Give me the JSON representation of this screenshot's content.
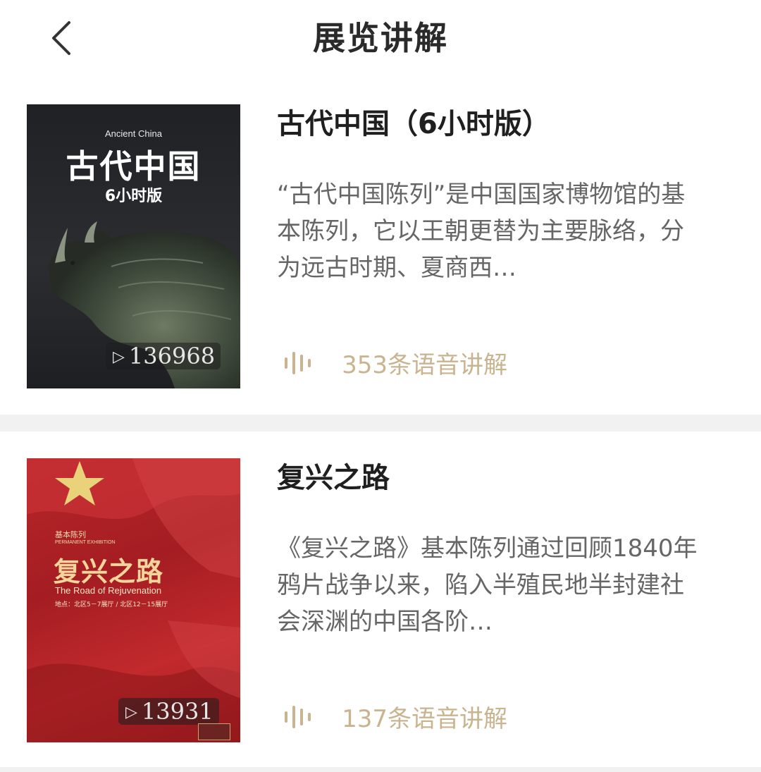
{
  "header": {
    "title": "展览讲解",
    "back_icon": "chevron-left-icon"
  },
  "exhibitions": [
    {
      "title": "古代中国（6小时版）",
      "description": "“古代中国陈列”是中国国家博物馆的基本陈列，它以王朝更替为主要脉络，分为远古时期、夏商西…",
      "audio_count_text": "353条语音讲解",
      "cover": {
        "english": "Ancient China",
        "chinese": "古代中国",
        "subtitle": "6小时版",
        "play_count": "136968"
      }
    },
    {
      "title": "复兴之路",
      "description": "《复兴之路》基本陈列通过回顾1840年鸦片战争以来，陷入半殖民地半封建社会深渊的中国各阶…",
      "audio_count_text": "137条语音讲解",
      "cover": {
        "label_cn": "基本陈列",
        "label_en": "PERMANENT EXHIBITION",
        "chinese": "复兴之路",
        "english": "The Road of Rejuvenation",
        "location": "地点：北区5－7展厅 / 北区12－15展厅",
        "play_count": "13931"
      }
    }
  ],
  "colors": {
    "accent_gold": "#c9b48f",
    "title": "#1f1f1f",
    "description": "#666666",
    "divider": "#f1f1f1"
  }
}
